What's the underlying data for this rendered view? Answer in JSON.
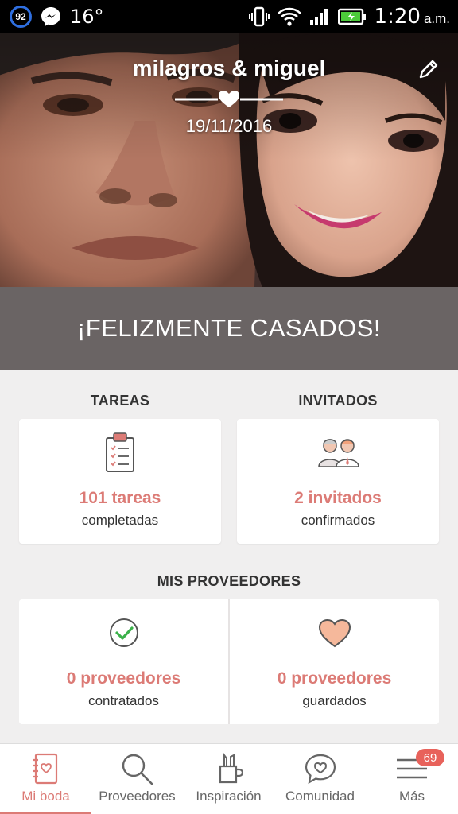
{
  "status_bar": {
    "notification_count": "92",
    "temperature": "16°",
    "time": "1:20",
    "ampm": "a.m."
  },
  "header": {
    "couple_name": "milagros & miguel",
    "wedding_date": "19/11/2016"
  },
  "banner": {
    "text": "¡FELIZMENTE CASADOS!"
  },
  "tasks": {
    "title": "TAREAS",
    "count": "101 tareas",
    "sub": "completadas",
    "icon": "clipboard-checklist-icon"
  },
  "guests": {
    "title": "INVITADOS",
    "count": "2 invitados",
    "sub": "confirmados",
    "icon": "guests-icon"
  },
  "vendors": {
    "title": "MIS PROVEEDORES",
    "hired": {
      "count": "0 proveedores",
      "sub": "contratados",
      "icon": "check-circle-icon"
    },
    "saved": {
      "count": "0 proveedores",
      "sub": "guardados",
      "icon": "heart-icon"
    }
  },
  "bottom_nav": {
    "items": [
      {
        "label": "Mi boda",
        "icon": "notebook-icon",
        "active": true
      },
      {
        "label": "Proveedores",
        "icon": "search-icon",
        "active": false
      },
      {
        "label": "Inspiración",
        "icon": "pencil-cup-icon",
        "active": false
      },
      {
        "label": "Comunidad",
        "icon": "chat-heart-icon",
        "active": false
      },
      {
        "label": "Más",
        "icon": "menu-icon",
        "active": false
      }
    ],
    "more_badge": "69"
  },
  "colors": {
    "accent": "#dc7b76",
    "banner": "#6a6464",
    "badge": "#e8625b",
    "background": "#f0efef"
  }
}
